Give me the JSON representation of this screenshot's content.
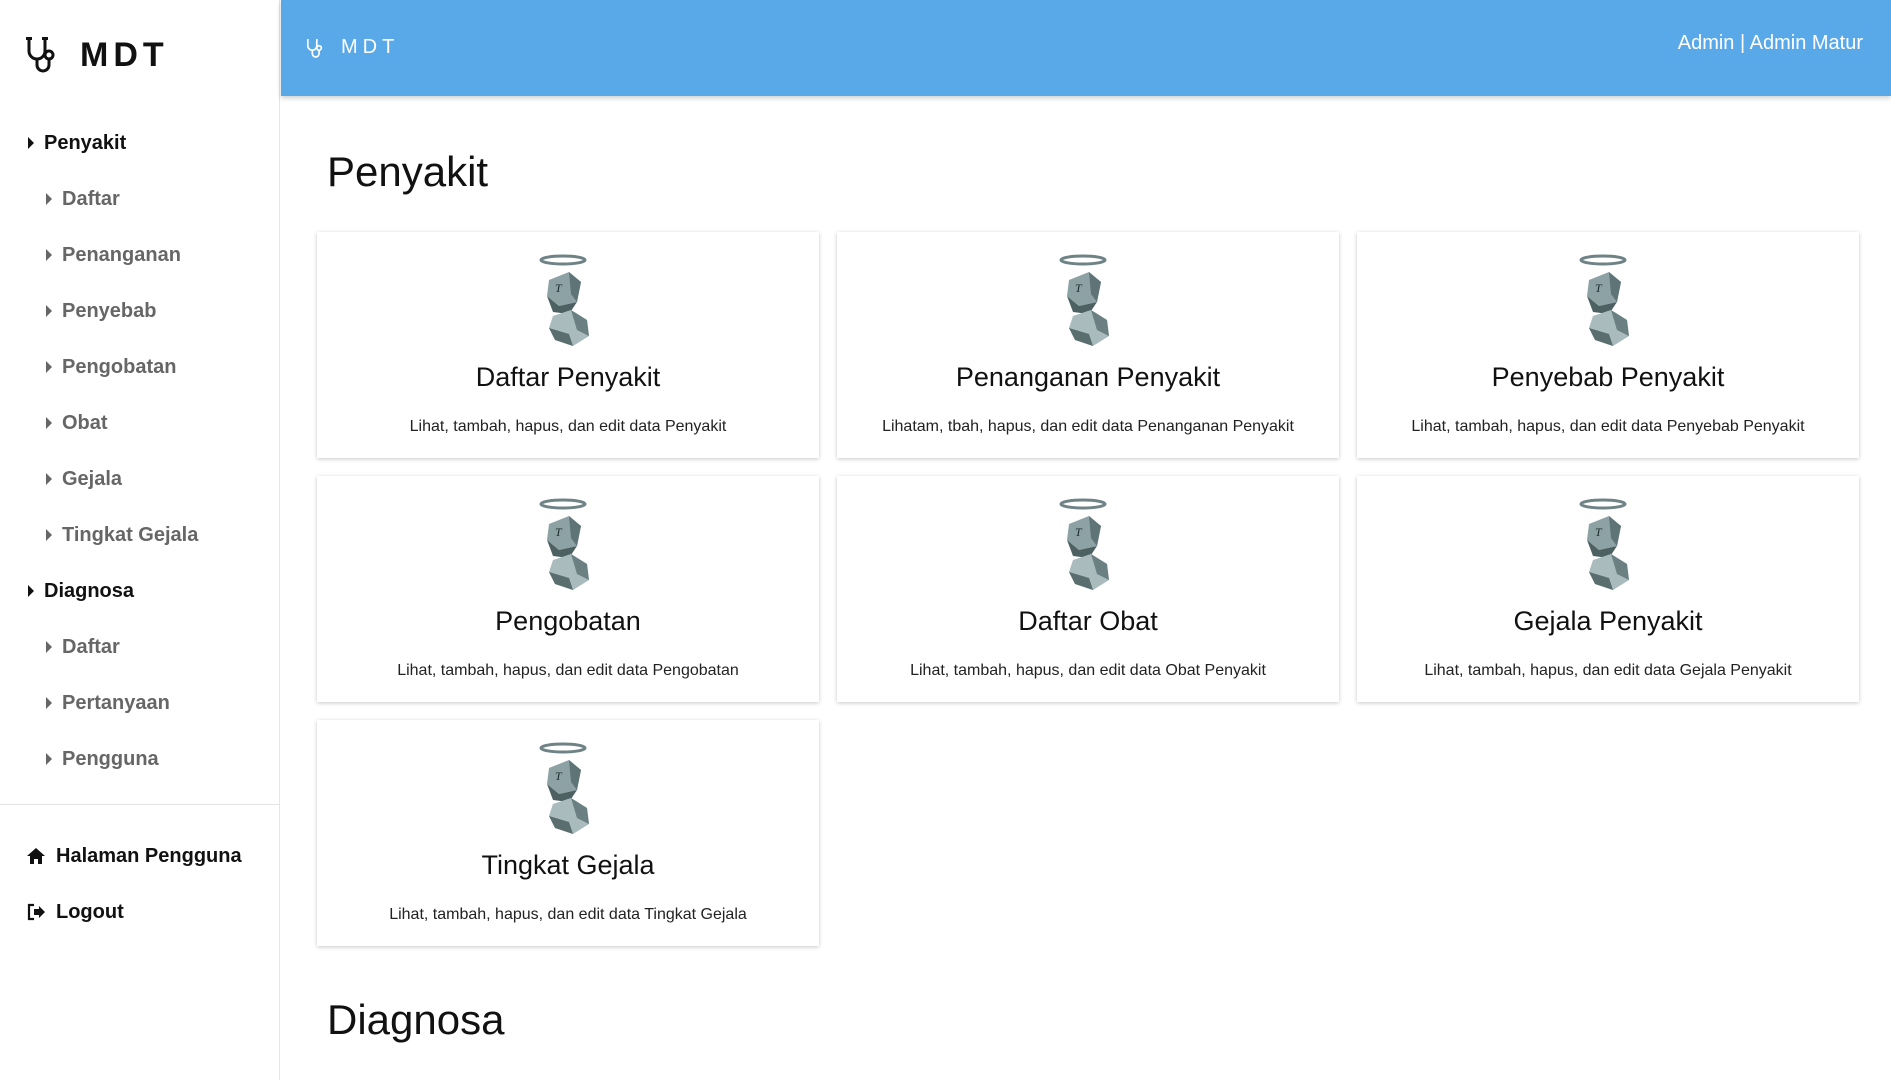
{
  "app": {
    "brand": "MDT"
  },
  "topbar": {
    "brand": "MDT",
    "user": "Admin | Admin Matur"
  },
  "sidebar": {
    "items": [
      {
        "label": "Penyakit",
        "type": "section"
      },
      {
        "label": "Daftar",
        "type": "sub"
      },
      {
        "label": "Penanganan",
        "type": "sub"
      },
      {
        "label": "Penyebab",
        "type": "sub"
      },
      {
        "label": "Pengobatan",
        "type": "sub"
      },
      {
        "label": "Obat",
        "type": "sub"
      },
      {
        "label": "Gejala",
        "type": "sub"
      },
      {
        "label": "Tingkat Gejala",
        "type": "sub"
      },
      {
        "label": "Diagnosa",
        "type": "section"
      },
      {
        "label": "Daftar",
        "type": "sub"
      },
      {
        "label": "Pertanyaan",
        "type": "sub"
      },
      {
        "label": "Pengguna",
        "type": "sub"
      }
    ],
    "bottom": [
      {
        "label": "Halaman Pengguna",
        "icon": "home-icon"
      },
      {
        "label": "Logout",
        "icon": "logout-icon"
      }
    ]
  },
  "main": {
    "sections": [
      {
        "title": "Penyakit"
      },
      {
        "title": "Diagnosa"
      }
    ],
    "cards": [
      {
        "title": "Daftar Penyakit",
        "desc": "Lihat, tambah, hapus, dan edit data Penyakit"
      },
      {
        "title": "Penanganan Penyakit",
        "desc": "Lihatam, tbah, hapus, dan edit data Penanganan Penyakit"
      },
      {
        "title": "Penyebab Penyakit",
        "desc": "Lihat, tambah, hapus, dan edit data Penyebab Penyakit"
      },
      {
        "title": "Pengobatan",
        "desc": "Lihat, tambah, hapus, dan edit data Pengobatan"
      },
      {
        "title": "Daftar Obat",
        "desc": "Lihat, tambah, hapus, dan edit data Obat Penyakit"
      },
      {
        "title": "Gejala Penyakit",
        "desc": "Lihat, tambah, hapus, dan edit data Gejala Penyakit"
      },
      {
        "title": "Tingkat Gejala",
        "desc": "Lihat, tambah, hapus, dan edit data Tingkat Gejala"
      }
    ]
  },
  "colors": {
    "topbar": "#59a9e9",
    "sub_text": "#666666"
  }
}
